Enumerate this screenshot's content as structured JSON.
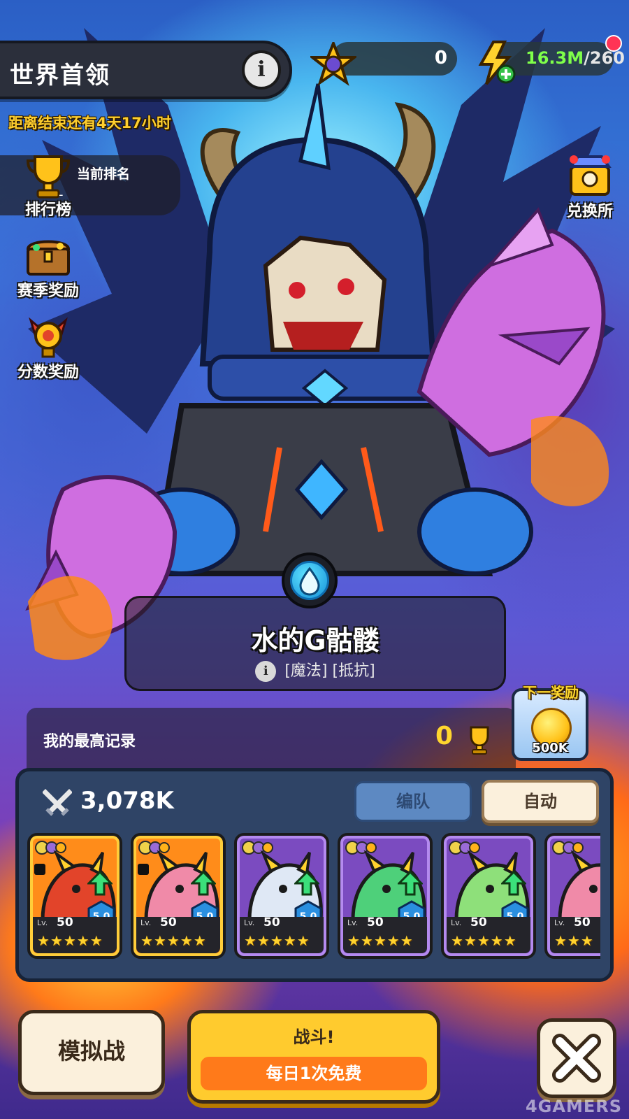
{
  "header": {
    "title": "世界首领",
    "info_glyph": "i",
    "countdown": "距离结束还有4天17小时"
  },
  "side_menu": {
    "current_rank_label": "当前排名",
    "current_rank_value": "-",
    "items": [
      {
        "label": "排行榜",
        "icon": "trophy-icon"
      },
      {
        "label": "赛季奖励",
        "icon": "treasure-chest-icon"
      },
      {
        "label": "分数奖励",
        "icon": "winged-medal-icon"
      }
    ]
  },
  "resources": {
    "medal_count": "0",
    "energy_value": "16.3M",
    "energy_max": "/260"
  },
  "exchange": {
    "label": "兑换所",
    "icon": "exchange-shop-icon"
  },
  "boss": {
    "element": "water",
    "name": "水的G骷髅",
    "tags": "[魔法] [抵抗]",
    "info_glyph": "i"
  },
  "record": {
    "label": "我的最高记录",
    "value": "0"
  },
  "next_reward": {
    "title": "下一奖励",
    "amount": "500K"
  },
  "team": {
    "power": "3,078K",
    "formation_label": "编队",
    "auto_label": "自动",
    "cards": [
      {
        "rarity": "orange",
        "level_prefix": "Lv.",
        "level": "50",
        "stars": "★★★★★",
        "rank": "5.0",
        "locked": true,
        "color": "#e2442a"
      },
      {
        "rarity": "orange",
        "level_prefix": "Lv.",
        "level": "50",
        "stars": "★★★★★",
        "rank": "5.0",
        "locked": true,
        "color": "#f08aa8"
      },
      {
        "rarity": "purple",
        "level_prefix": "Lv.",
        "level": "50",
        "stars": "★★★★★",
        "rank": "5.0",
        "locked": false,
        "color": "#dfe8f5"
      },
      {
        "rarity": "purple",
        "level_prefix": "Lv.",
        "level": "50",
        "stars": "★★★★★",
        "rank": "5.0",
        "locked": false,
        "color": "#4ed07a"
      },
      {
        "rarity": "purple",
        "level_prefix": "Lv.",
        "level": "50",
        "stars": "★★★★★",
        "rank": "5.0",
        "locked": false,
        "color": "#8ee07a"
      },
      {
        "rarity": "purple",
        "level_prefix": "Lv.",
        "level": "50",
        "stars": "★★★",
        "rank": "",
        "locked": false,
        "color": "#f08aa8"
      }
    ]
  },
  "actions": {
    "simulate_label": "模拟战",
    "fight_label": "战斗!",
    "fight_sub": "每日1次免费"
  },
  "watermark": "4GAMERS"
}
